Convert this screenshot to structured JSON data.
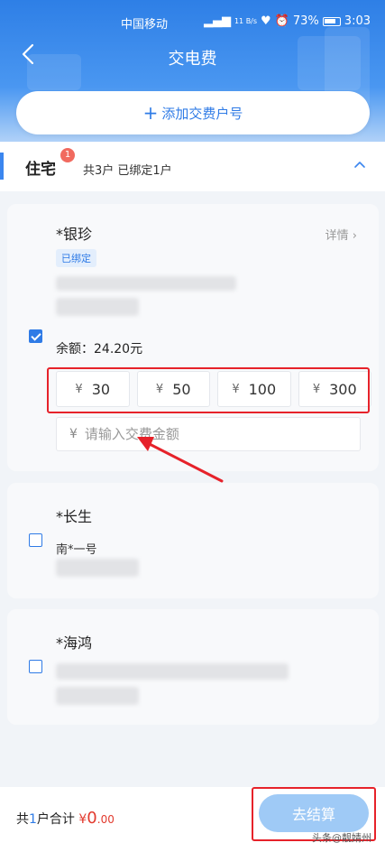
{
  "status_bar": {
    "carrier": "中国移动",
    "network_speed": "11 B/s",
    "battery": "73%",
    "time": "3:03"
  },
  "header": {
    "title": "交电费",
    "add_account_label": "添加交费户号"
  },
  "category": {
    "title": "住宅",
    "badge": "1",
    "summary": "共3户 已绑定1户"
  },
  "accounts": [
    {
      "name": "*银珍",
      "details_label": "详情",
      "bound_tag": "已绑定",
      "balance": "余额：24.20元",
      "checked": true,
      "amount_options": [
        "30",
        "50",
        "100",
        "300"
      ],
      "currency_symbol": "¥",
      "amount_placeholder": "请输入交费金额"
    },
    {
      "name": "*长生",
      "address": "南*一号",
      "checked": false
    },
    {
      "name": "*海鸿",
      "checked": false
    }
  ],
  "footer": {
    "total_prefix": "共",
    "total_count": "1",
    "total_mid": "户合计",
    "total_currency": "¥",
    "total_int": "0",
    "total_dec": ".00",
    "checkout_label": "去结算",
    "watermark": "头条@靓婧州"
  },
  "colors": {
    "accent": "#2f7be6",
    "header_top": "#2e7fe6",
    "highlight": "#e6222a",
    "price": "#e23a2e",
    "checkout": "#9fcaf6"
  }
}
